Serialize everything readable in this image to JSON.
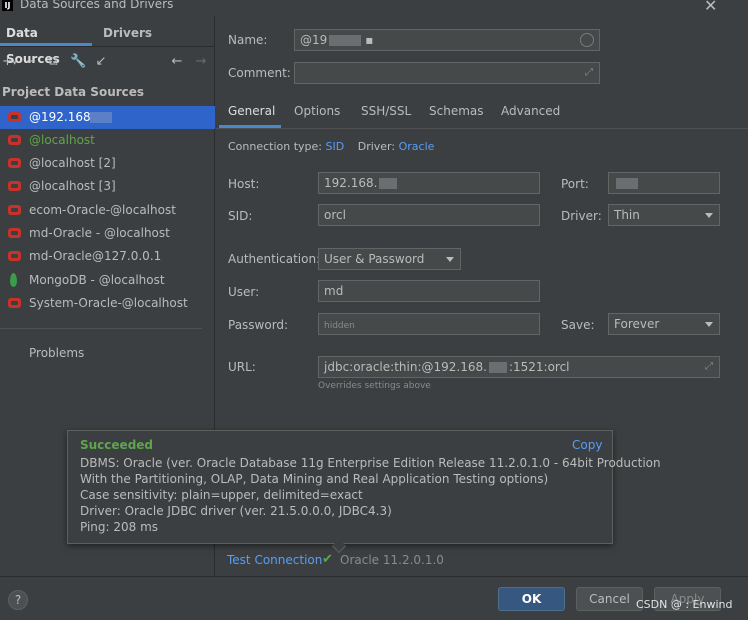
{
  "window": {
    "title": "Data Sources and Drivers",
    "app_icon": "IJ"
  },
  "left": {
    "tabs": [
      "Data Sources",
      "Drivers"
    ],
    "section_label": "Project Data Sources",
    "items": [
      {
        "label": "@192.168.",
        "icon": "oracle-icon"
      },
      {
        "label": "@localhost",
        "icon": "oracle-icon"
      },
      {
        "label": "@localhost [2]",
        "icon": "oracle-icon"
      },
      {
        "label": "@localhost [3]",
        "icon": "oracle-icon"
      },
      {
        "label": "ecom-Oracle-@localhost",
        "icon": "oracle-icon"
      },
      {
        "label": "md-Oracle - @localhost",
        "icon": "oracle-icon"
      },
      {
        "label": "md-Oracle@127.0.0.1",
        "icon": "oracle-icon"
      },
      {
        "label": "MongoDB - @localhost",
        "icon": "mongodb-leaf-icon"
      },
      {
        "label": "System-Oracle-@localhost",
        "icon": "oracle-icon"
      }
    ],
    "problems": "Problems"
  },
  "form": {
    "name_label": "Name:",
    "name_value": "@19",
    "comment_label": "Comment:",
    "tabs": [
      "General",
      "Options",
      "SSH/SSL",
      "Schemas",
      "Advanced"
    ],
    "conn_type_label": "Connection type:",
    "conn_type_value": "SID",
    "driver_label": "Driver:",
    "driver_value": "Oracle",
    "host_label": "Host:",
    "host_value": "192.168.",
    "port_label": "Port:",
    "sid_label": "SID:",
    "sid_value": "orcl",
    "driver2_label": "Driver:",
    "driver2_value": "Thin",
    "auth_label": "Authentication:",
    "auth_value": "User & Password",
    "user_label": "User:",
    "user_value": "md",
    "password_label": "Password:",
    "password_value": "hidden",
    "save_label": "Save:",
    "save_value": "Forever",
    "url_label": "URL:",
    "url_prefix": "jdbc:oracle:thin:@192.168.",
    "url_suffix": ":1521:orcl",
    "url_hint": "Overrides settings above"
  },
  "popup": {
    "status": "Succeeded",
    "copy": "Copy",
    "lines": [
      "DBMS: Oracle (ver. Oracle Database 11g Enterprise Edition Release 11.2.0.1.0 - 64bit Production",
      "With the Partitioning, OLAP, Data Mining and Real Application Testing options)",
      "Case sensitivity: plain=upper, delimited=exact",
      "Driver: Oracle JDBC driver (ver. 21.5.0.0.0, JDBC4.3)",
      "Ping: 208 ms"
    ]
  },
  "test": {
    "label": "Test Connection",
    "version": "Oracle 11.2.0.1.0"
  },
  "footer": {
    "help": "?",
    "ok": "OK",
    "cancel": "Cancel",
    "apply": "Apply",
    "watermark": "CSDN @ : Enwind"
  }
}
